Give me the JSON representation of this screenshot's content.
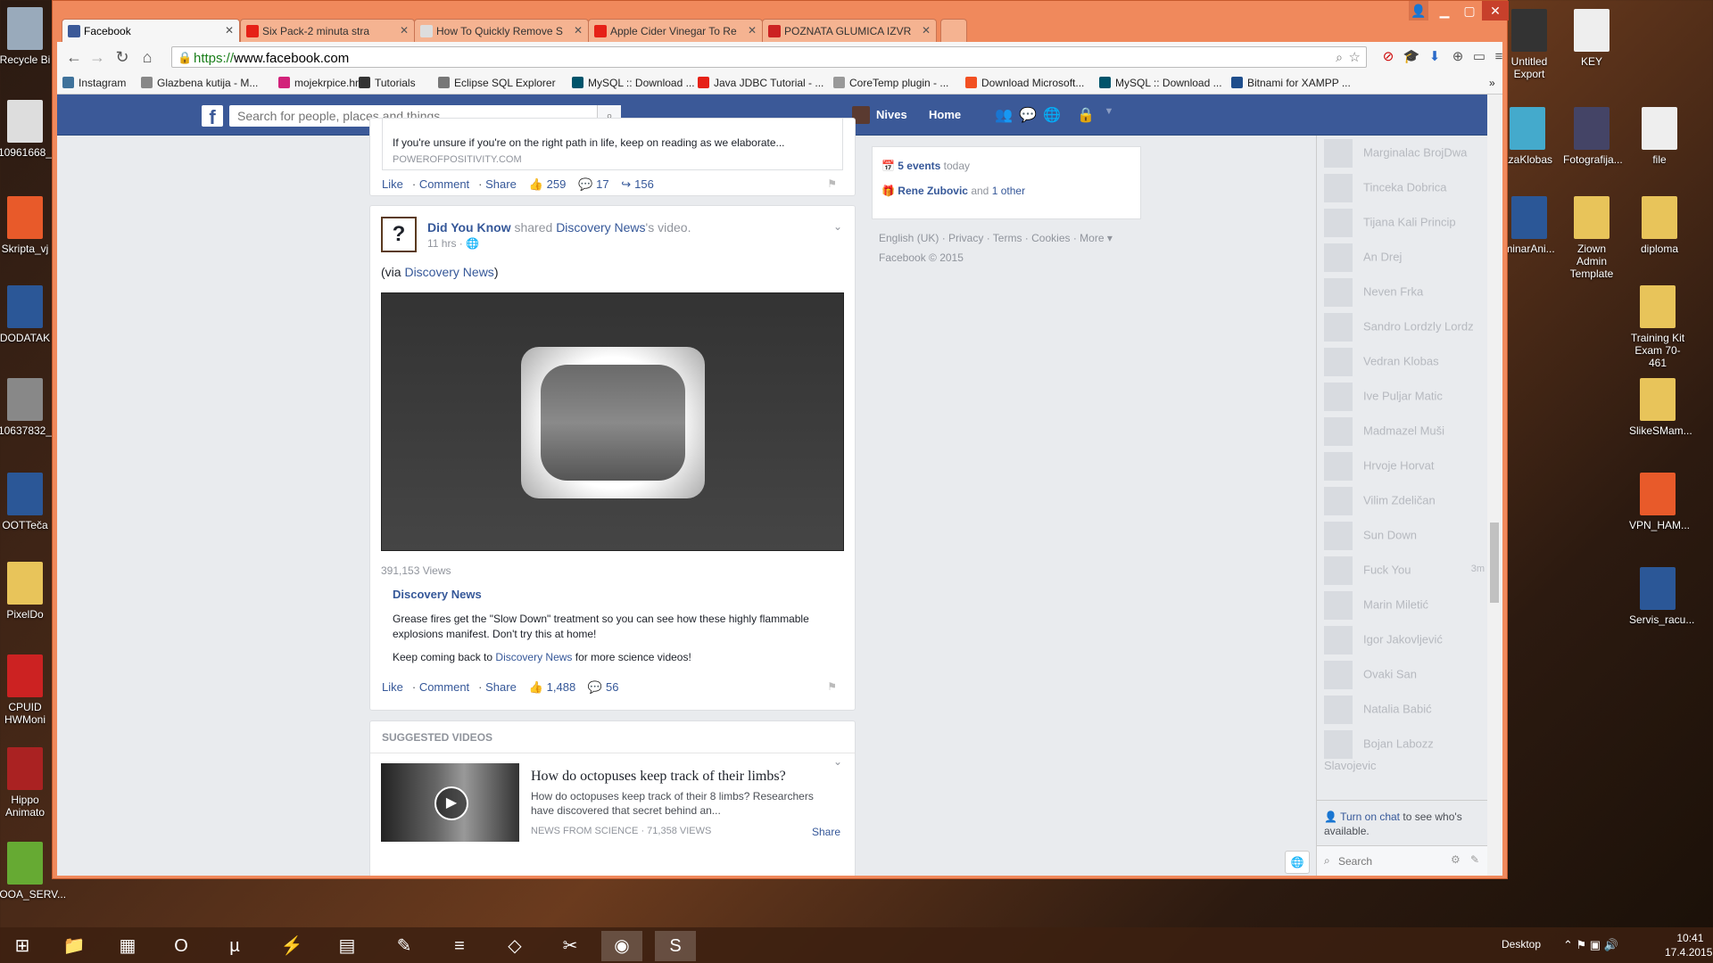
{
  "desktop_left": [
    {
      "label": "Recycle Bi",
      "color": "#9ab"
    },
    {
      "label": "10961668_",
      "color": "#ddd"
    },
    {
      "label": "Skripta_vj",
      "color": "#e85a2a"
    },
    {
      "label": "DODATAK",
      "color": "#2b5797"
    },
    {
      "label": "10637832_",
      "color": "#888"
    },
    {
      "label": "OOTTeča",
      "color": "#2b5797"
    },
    {
      "label": "PixelDo",
      "color": "#e8c45a"
    },
    {
      "label": "CPUID HWMoni",
      "color": "#c22"
    },
    {
      "label": "Hippo Animato",
      "color": "#a22"
    },
    {
      "label": "IOOA_SERV...",
      "color": "#6a3"
    }
  ],
  "desktop_right": [
    {
      "label": "Untitled Export",
      "color": "#333"
    },
    {
      "label": "KEY",
      "color": "#eee"
    },
    {
      "label": "azaKlobas",
      "color": "#4ac"
    },
    {
      "label": "Fotografija...",
      "color": "#446"
    },
    {
      "label": "file",
      "color": "#eee"
    },
    {
      "label": "minarAni...",
      "color": "#2b5797"
    },
    {
      "label": "Ziown Admin Template",
      "color": "#e8c45a"
    },
    {
      "label": "diploma",
      "color": "#e8c45a"
    },
    {
      "label": "Training Kit Exam 70-461",
      "color": "#e8c45a"
    },
    {
      "label": "SlikeSMam...",
      "color": "#e8c45a"
    },
    {
      "label": "VPN_HAM...",
      "color": "#e85a2a"
    },
    {
      "label": "Servis_racu...",
      "color": "#2b5797"
    }
  ],
  "tabs": [
    {
      "label": "Facebook",
      "color": "#3b5998"
    },
    {
      "label": "Six Pack-2 minuta stra",
      "color": "#e62117"
    },
    {
      "label": "How To Quickly Remove S",
      "color": "#ddd"
    },
    {
      "label": "Apple Cider Vinegar To Re",
      "color": "#e62117"
    },
    {
      "label": "POZNATA GLUMICA IZVR",
      "color": "#c22"
    }
  ],
  "url": {
    "scheme": "https://",
    "host": "www.facebook.com"
  },
  "bookmarks": [
    {
      "label": "Instagram",
      "color": "#3f729b"
    },
    {
      "label": "Glazbena kutija - M...",
      "color": "#888"
    },
    {
      "label": "mojekrpice.hr",
      "color": "#d2227a"
    },
    {
      "label": "Tutorials",
      "color": "#333"
    },
    {
      "label": "Eclipse SQL Explorer",
      "color": "#777"
    },
    {
      "label": "MySQL :: Download ...",
      "color": "#00546b"
    },
    {
      "label": "Java JDBC Tutorial - ...",
      "color": "#e62117"
    },
    {
      "label": "CoreTemp plugin - ...",
      "color": "#999"
    },
    {
      "label": "Download Microsoft...",
      "color": "#f25022"
    },
    {
      "label": "MySQL :: Download ...",
      "color": "#00546b"
    },
    {
      "label": "Bitnami for XAMPP ...",
      "color": "#1f4e8c"
    }
  ],
  "fb": {
    "search_placeholder": "Search for people, places and things",
    "user": "Nives",
    "home": "Home"
  },
  "post1": {
    "desc": "If you're unsure if you're on the right path in life, keep on reading as we elaborate...",
    "source": "POWEROFPOSITIVITY.COM",
    "like": "Like",
    "comment": "Comment",
    "share": "Share",
    "likes": "259",
    "comments": "17",
    "shares": "156"
  },
  "post2": {
    "author": "Did You Know",
    "shared": "shared",
    "page": "Discovery News",
    "suffix": "'s video.",
    "time": "11 hrs",
    "via_prefix": "(via ",
    "via": "Discovery News",
    "via_suffix": ")",
    "views": "391,153 Views",
    "video_title": "Discovery News",
    "video_desc": "Grease fires get the \"Slow Down\" treatment so you can see how these highly flammable explosions manifest. Don't try this at home!",
    "more_prefix": "Keep coming back to ",
    "more_link": "Discovery News",
    "more_suffix": " for more science videos!",
    "like": "Like",
    "comment": "Comment",
    "share": "Share",
    "likes": "1,488",
    "comments": "56"
  },
  "suggested": {
    "header": "SUGGESTED VIDEOS",
    "title": "How do octopuses keep track of their limbs?",
    "desc": "How do octopuses keep track of their 8 limbs? Researchers have discovered that secret behind an...",
    "source": "NEWS FROM SCIENCE · 71,358 VIEWS",
    "share": "Share"
  },
  "events": {
    "count": "5 events",
    "today": "today",
    "bday_name": "Rene Zubovic",
    "bday_and": "and",
    "bday_other": "1 other"
  },
  "footer": {
    "links": "English (UK) · Privacy · Terms · Cookies · More ▾",
    "copy": "Facebook © 2015"
  },
  "friends": [
    "Marginalac BrojDwa",
    "Tinceka Dobrica",
    "Tijana Kali Princip",
    "An Drej",
    "Neven Frka",
    "Sandro Lordzly Lordz",
    "Vedran Klobas",
    "Ive Puljar Matic",
    "Madmazel Muši",
    "Hrvoje Horvat",
    "Vilim Zdeličan",
    "Sun Down",
    "Fuck You",
    "Marin Miletić",
    "Igor Jakovljević",
    "Ovaki San",
    "Natalia Babić",
    "Bojan Labozz Slavojevic"
  ],
  "friend_idle": "3m",
  "chat": {
    "turn_on": "Turn on chat",
    "rest": "to see who's available.",
    "search": "Search"
  },
  "taskbar": {
    "items": [
      "⊞",
      "📁",
      "▦",
      "O",
      "µ",
      "⚡",
      "▤",
      "✎",
      "≡",
      "◇",
      "✂",
      "◉",
      "S"
    ],
    "desktop": "Desktop",
    "time": "10:41",
    "date": "17.4.2015."
  },
  "colors": {
    "fb_blue": "#3b5998",
    "link": "#365899",
    "chrome_frame": "#f0895c"
  }
}
